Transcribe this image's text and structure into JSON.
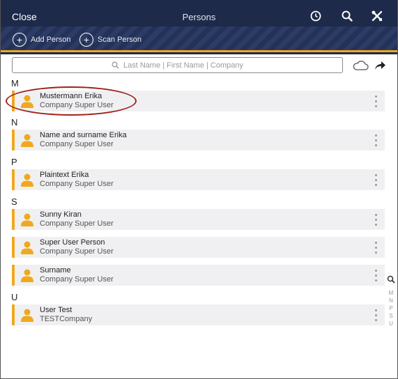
{
  "nav": {
    "close_label": "Close",
    "title": "Persons",
    "icons": [
      "clock-icon",
      "search-icon",
      "tools-icon"
    ]
  },
  "actions": {
    "add_person": "Add Person",
    "scan_person": "Scan Person"
  },
  "search": {
    "placeholder": "Last Name | First Name | Company"
  },
  "sections": [
    {
      "letter": "M",
      "persons": [
        {
          "name": "Mustermann Erika",
          "role": "Company Super User"
        }
      ]
    },
    {
      "letter": "N",
      "persons": [
        {
          "name": "Name and surname Erika",
          "role": "Company Super User"
        }
      ]
    },
    {
      "letter": "P",
      "persons": [
        {
          "name": "Plaintext Erika",
          "role": "Company Super User"
        }
      ]
    },
    {
      "letter": "S",
      "persons": [
        {
          "name": "Sunny Kiran",
          "role": "Company Super User"
        },
        {
          "name": "Super User Person",
          "role": "Company Super User"
        },
        {
          "name": "Surname",
          "role": "Company Super User"
        }
      ]
    },
    {
      "letter": "U",
      "persons": [
        {
          "name": "User Test",
          "role": "TESTCompany"
        }
      ]
    }
  ],
  "index_letters": [
    "M",
    "N",
    "P",
    "S",
    "U"
  ],
  "colors": {
    "nav_bg": "#1e2a4a",
    "accent": "#f0a81e",
    "row_bg": "#f0f0f2",
    "highlight": "#a0221c"
  }
}
